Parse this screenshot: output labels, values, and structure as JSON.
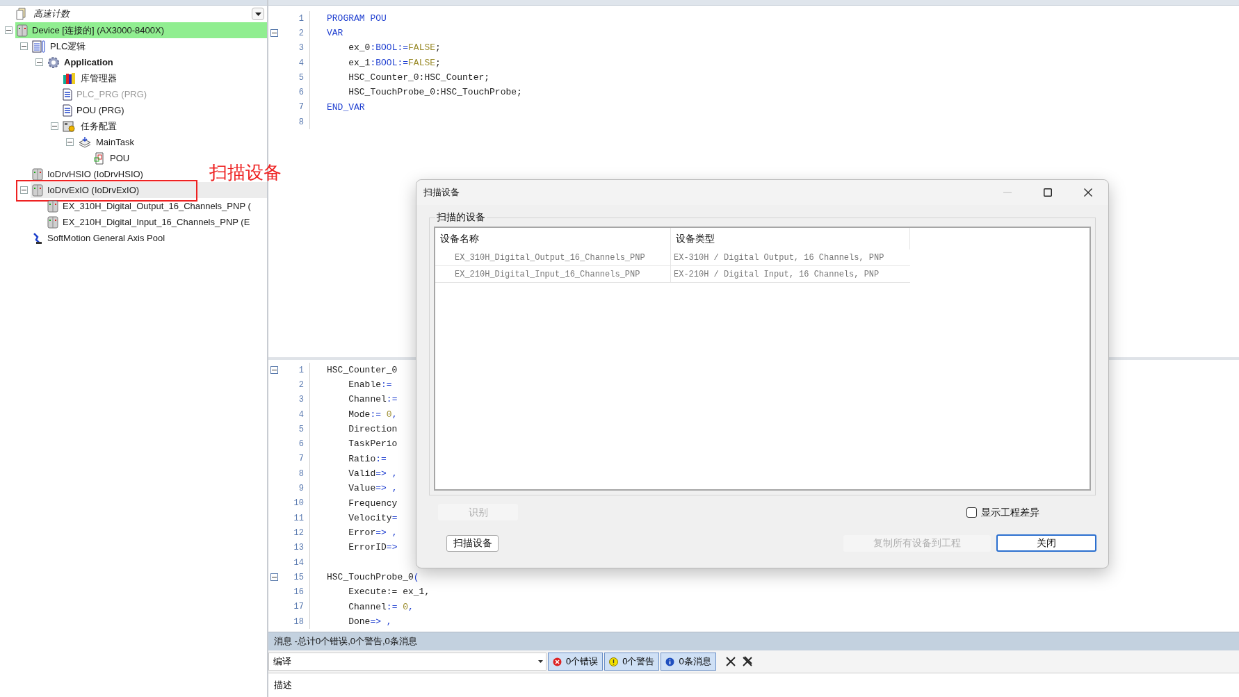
{
  "project": {
    "name": "高速计数"
  },
  "tree": [
    {
      "label": "Device [连接的] (AX3000-8400X)",
      "kind": "device",
      "connected": true,
      "selected": false,
      "disabled": false,
      "bold": false,
      "annotated": false,
      "expanded": true,
      "children": [
        {
          "label": "PLC逻辑",
          "kind": "plc",
          "connected": false,
          "selected": false,
          "disabled": false,
          "bold": false,
          "annotated": false,
          "expanded": true,
          "children": [
            {
              "label": "Application",
              "kind": "application",
              "connected": false,
              "selected": false,
              "disabled": false,
              "bold": true,
              "annotated": false,
              "expanded": true,
              "children": [
                {
                  "label": "库管理器",
                  "kind": "library",
                  "connected": false,
                  "selected": false,
                  "disabled": false,
                  "bold": false,
                  "annotated": false
                },
                {
                  "label": "PLC_PRG (PRG)",
                  "kind": "program",
                  "connected": false,
                  "selected": false,
                  "disabled": true,
                  "bold": false,
                  "annotated": false
                },
                {
                  "label": "POU (PRG)",
                  "kind": "program",
                  "connected": false,
                  "selected": false,
                  "disabled": false,
                  "bold": false,
                  "annotated": false
                },
                {
                  "label": "任务配置",
                  "kind": "taskconfig",
                  "connected": false,
                  "selected": false,
                  "disabled": false,
                  "bold": false,
                  "annotated": false,
                  "expanded": true,
                  "children": [
                    {
                      "label": "MainTask",
                      "kind": "task",
                      "connected": false,
                      "selected": false,
                      "disabled": false,
                      "bold": false,
                      "annotated": false,
                      "expanded": true,
                      "children": [
                        {
                          "label": "POU",
                          "kind": "call",
                          "connected": false,
                          "selected": false,
                          "disabled": false,
                          "bold": false,
                          "annotated": false
                        }
                      ]
                    }
                  ]
                }
              ]
            }
          ]
        },
        {
          "label": "IoDrvHSIO (IoDrvHSIO)",
          "kind": "device",
          "connected": false,
          "selected": false,
          "disabled": false,
          "bold": false,
          "annotated": false
        },
        {
          "label": "IoDrvExIO (IoDrvExIO)",
          "kind": "device",
          "connected": false,
          "selected": true,
          "disabled": false,
          "bold": false,
          "annotated": true,
          "expanded": true,
          "children": [
            {
              "label": "EX_310H_Digital_Output_16_Channels_PNP (",
              "kind": "device",
              "connected": false,
              "selected": false,
              "disabled": false,
              "bold": false,
              "annotated": false
            },
            {
              "label": "EX_210H_Digital_Input_16_Channels_PNP (E",
              "kind": "device",
              "connected": false,
              "selected": false,
              "disabled": false,
              "bold": false,
              "annotated": false
            }
          ]
        },
        {
          "label": "SoftMotion General Axis Pool",
          "kind": "axis",
          "connected": false,
          "selected": false,
          "disabled": false,
          "bold": false,
          "annotated": false
        }
      ]
    }
  ],
  "annotation": {
    "text": "扫描设备"
  },
  "editor_top": {
    "lines": [
      {
        "number": "1",
        "fold": false,
        "segments": [
          {
            "text": "PROGRAM POU",
            "kind": "kw"
          }
        ]
      },
      {
        "number": "2",
        "fold": true,
        "segments": [
          {
            "text": "VAR",
            "kind": "kw"
          }
        ]
      },
      {
        "number": "3",
        "fold": false,
        "segments": [
          {
            "text": "    ex_0",
            "kind": "id"
          },
          {
            "text": ":BOOL:=",
            "kind": "kw"
          },
          {
            "text": "FALSE",
            "kind": "lit"
          },
          {
            "text": ";",
            "kind": "id"
          }
        ]
      },
      {
        "number": "4",
        "fold": false,
        "segments": [
          {
            "text": "    ex_1",
            "kind": "id"
          },
          {
            "text": ":BOOL:=",
            "kind": "kw"
          },
          {
            "text": "FALSE",
            "kind": "lit"
          },
          {
            "text": ";",
            "kind": "id"
          }
        ]
      },
      {
        "number": "5",
        "fold": false,
        "segments": [
          {
            "text": "    HSC_Counter_0:HSC_Counter;",
            "kind": "id"
          }
        ]
      },
      {
        "number": "6",
        "fold": false,
        "segments": [
          {
            "text": "    HSC_TouchProbe_0:HSC_TouchProbe;",
            "kind": "id"
          }
        ]
      },
      {
        "number": "7",
        "fold": false,
        "segments": [
          {
            "text": "END_VAR",
            "kind": "kw"
          }
        ]
      },
      {
        "number": "8",
        "fold": false
      }
    ]
  },
  "editor_bottom": {
    "lines": [
      {
        "number": "1",
        "fold": true,
        "segments": [
          {
            "text": "HSC_Counter_0",
            "kind": "id"
          }
        ]
      },
      {
        "number": "2",
        "fold": false,
        "segments": [
          {
            "text": "    Enable",
            "kind": "id"
          },
          {
            "text": ":=",
            "kind": "kw"
          }
        ]
      },
      {
        "number": "3",
        "fold": false,
        "segments": [
          {
            "text": "    Channel",
            "kind": "id"
          },
          {
            "text": ":=",
            "kind": "kw"
          }
        ]
      },
      {
        "number": "4",
        "fold": false,
        "segments": [
          {
            "text": "    Mode",
            "kind": "id"
          },
          {
            "text": ":=",
            "kind": "kw"
          },
          {
            "text": " 0",
            "kind": "lit"
          },
          {
            "text": ",",
            "kind": "kw"
          }
        ]
      },
      {
        "number": "5",
        "fold": false,
        "segments": [
          {
            "text": "    Direction",
            "kind": "id"
          }
        ]
      },
      {
        "number": "6",
        "fold": false,
        "segments": [
          {
            "text": "    TaskPerio",
            "kind": "id"
          }
        ]
      },
      {
        "number": "7",
        "fold": false,
        "segments": [
          {
            "text": "    Ratio",
            "kind": "id"
          },
          {
            "text": ":=",
            "kind": "kw"
          }
        ]
      },
      {
        "number": "8",
        "fold": false,
        "segments": [
          {
            "text": "    Valid",
            "kind": "id"
          },
          {
            "text": "=>",
            "kind": "kw"
          },
          {
            "text": " ,",
            "kind": "kw"
          }
        ]
      },
      {
        "number": "9",
        "fold": false,
        "segments": [
          {
            "text": "    Value",
            "kind": "id"
          },
          {
            "text": "=>",
            "kind": "kw"
          },
          {
            "text": " ,",
            "kind": "kw"
          }
        ]
      },
      {
        "number": "10",
        "fold": false,
        "segments": [
          {
            "text": "    Frequency",
            "kind": "id"
          }
        ]
      },
      {
        "number": "11",
        "fold": false,
        "segments": [
          {
            "text": "    Velocity",
            "kind": "id"
          },
          {
            "text": "=",
            "kind": "kw"
          }
        ]
      },
      {
        "number": "12",
        "fold": false,
        "segments": [
          {
            "text": "    Error",
            "kind": "id"
          },
          {
            "text": "=>",
            "kind": "kw"
          },
          {
            "text": " ,",
            "kind": "kw"
          }
        ]
      },
      {
        "number": "13",
        "fold": false,
        "segments": [
          {
            "text": "    ErrorID",
            "kind": "id"
          },
          {
            "text": "=>",
            "kind": "kw"
          }
        ]
      },
      {
        "number": "14",
        "fold": false
      },
      {
        "number": "15",
        "fold": true,
        "segments": [
          {
            "text": "HSC_TouchProbe_0",
            "kind": "id"
          },
          {
            "text": "(",
            "kind": "kw"
          }
        ]
      },
      {
        "number": "16",
        "fold": false,
        "segments": [
          {
            "text": "    Execute:= ex_1,",
            "kind": "id"
          }
        ]
      },
      {
        "number": "17",
        "fold": false,
        "segments": [
          {
            "text": "    Channel",
            "kind": "id"
          },
          {
            "text": ":=",
            "kind": "kw"
          },
          {
            "text": " 0",
            "kind": "lit"
          },
          {
            "text": ",",
            "kind": "kw"
          }
        ]
      },
      {
        "number": "18",
        "fold": false,
        "segments": [
          {
            "text": "    Done",
            "kind": "id"
          },
          {
            "text": "=>",
            "kind": "kw"
          },
          {
            "text": " ,",
            "kind": "kw"
          }
        ]
      }
    ]
  },
  "dialog": {
    "title": "扫描设备",
    "group": "扫描的设备",
    "columns": [
      "设备名称",
      "设备类型"
    ],
    "rows": [
      {
        "name": "EX_310H_Digital_Output_16_Channels_PNP",
        "type": "EX-310H / Digital Output, 16 Channels, PNP"
      },
      {
        "name": "EX_210H_Digital_Input_16_Channels_PNP",
        "type": "EX-210H / Digital Input, 16 Channels, PNP"
      }
    ],
    "identify_button": {
      "label": "识别",
      "disabled": true
    },
    "show_diff": {
      "label": "显示工程差异",
      "checked": false
    },
    "scan_button": {
      "label": "扫描设备",
      "disabled": false
    },
    "copy_button": {
      "label": "复制所有设备到工程",
      "disabled": true
    },
    "close_button": {
      "label": "关闭"
    }
  },
  "messages": {
    "title": "消息 -总计0个错误,0个警告,0条消息",
    "source": "编译",
    "filters": [
      {
        "kind": "error",
        "label": "0个错误",
        "selected": true
      },
      {
        "kind": "warning",
        "label": "0个警告",
        "selected": true
      },
      {
        "kind": "info",
        "label": "0条消息",
        "selected": true
      }
    ],
    "column": "描述"
  }
}
